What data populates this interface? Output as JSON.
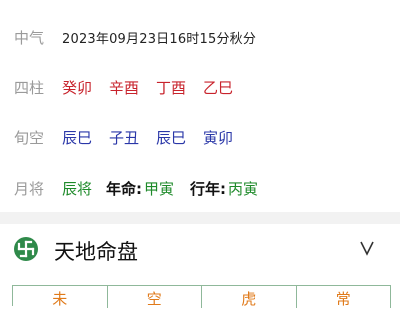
{
  "zhongqi": {
    "label": "中气",
    "value": "2023年09月23日16时15分秋分"
  },
  "sizhu": {
    "label": "四柱",
    "items": [
      "癸卯",
      "辛酉",
      "丁酉",
      "乙巳"
    ]
  },
  "xunkong": {
    "label": "旬空",
    "items": [
      "辰巳",
      "子丑",
      "辰巳",
      "寅卯"
    ]
  },
  "yuejiang": {
    "label": "月将",
    "value": "辰将",
    "nianming_label": "年命:",
    "nianming_value": "甲寅",
    "xingnian_label": "行年:",
    "xingnian_value": "丙寅"
  },
  "panel": {
    "title": "天地命盘",
    "toggle": "V",
    "icon": "swastika-logo-icon"
  },
  "grid_header": [
    "未",
    "空",
    "虎",
    "常"
  ],
  "colors": {
    "red": "#c8232c",
    "blue": "#2a37a8",
    "green": "#1e8a2a",
    "accent": "#2f8a4a",
    "orange": "#e07a1a"
  }
}
